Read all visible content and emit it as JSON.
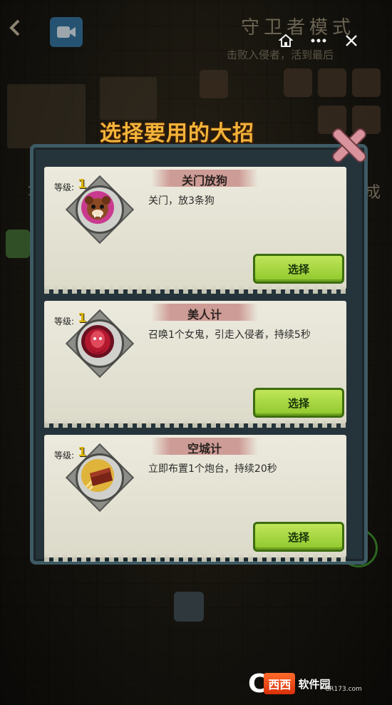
{
  "top_bar": {
    "back_icon": "chevron-left-icon",
    "video_icon": "video-camera-icon",
    "mode_title": "守卫者模式",
    "mode_subtitle": "击败入侵者，活到最后",
    "home_icon": "home-icon",
    "more_icon": "more-icon",
    "close_icon": "close-icon"
  },
  "background": {
    "side_number": "1",
    "side_right_text": "完成"
  },
  "dialog": {
    "title": "选择要用的大招",
    "close_icon": "close-x-icon",
    "level_label": "等级:",
    "cards": [
      {
        "name": "关门放狗",
        "description": "关门，放3条狗",
        "level": "1",
        "icon": "dog-icon",
        "button": "选择"
      },
      {
        "name": "美人计",
        "description": "召唤1个女鬼，引走入侵者，持续5秒",
        "level": "1",
        "icon": "ghost-girl-icon",
        "button": "选择"
      },
      {
        "name": "空城计",
        "description": "立即布置1个炮台，持续20秒",
        "level": "1",
        "icon": "turret-icon",
        "button": "选择"
      }
    ]
  },
  "watermark": {
    "letter": "C",
    "brand": "西西",
    "text": "软件园",
    "url": "CR173.com"
  }
}
